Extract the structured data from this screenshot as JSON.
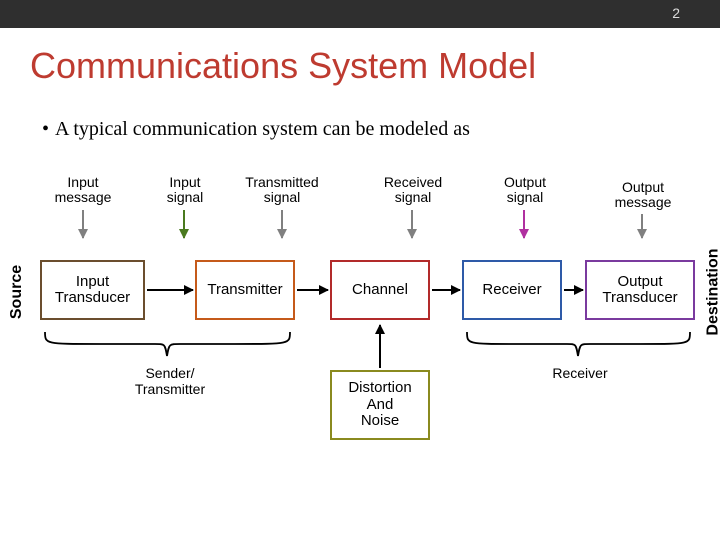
{
  "page_number": "2",
  "title": "Communications System Model",
  "bullet": "A typical communication system can be modeled as",
  "signals": {
    "input_message": "Input\nmessage",
    "input_signal": "Input\nsignal",
    "transmitted_signal": "Transmitted\nsignal",
    "received_signal": "Received\nsignal",
    "output_signal": "Output\nsignal",
    "output_message": "Output\nmessage"
  },
  "boxes": {
    "input_transducer": "Input\nTransducer",
    "transmitter": "Transmitter",
    "channel": "Channel",
    "receiver": "Receiver",
    "output_transducer": "Output\nTransducer",
    "distortion_noise": "Distortion\nAnd\nNoise"
  },
  "side_labels": {
    "source": "Source",
    "destination": "Destination"
  },
  "braces": {
    "sender": "Sender/\nTransmitter",
    "receiver": "Receiver"
  },
  "colors": {
    "title": "#be3b30",
    "input_transducer_border": "#6b4e2e",
    "transmitter_border": "#c55a1a",
    "channel_border": "#b22a2a",
    "receiver_border": "#2e5aa8",
    "output_transducer_border": "#7a3a9e",
    "distortion_border": "#8a8a1f",
    "arrow_green": "#4a7a1f",
    "arrow_magenta": "#b030a0",
    "arrow_blue": "#2e5aa8"
  }
}
